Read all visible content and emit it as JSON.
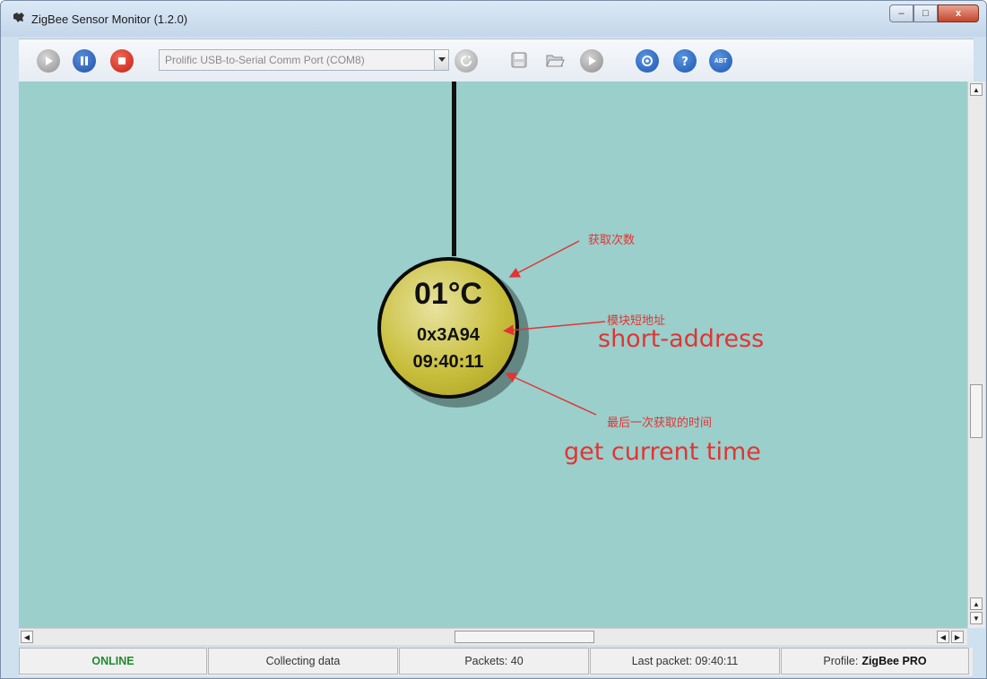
{
  "window": {
    "title": "ZigBee Sensor Monitor (1.2.0)",
    "controls": {
      "minimize": "–",
      "maximize": "□",
      "close": "x"
    }
  },
  "toolbar": {
    "port_select_value": "Prolific USB-to-Serial Comm Port (COM8)",
    "about_label": "ABT"
  },
  "node": {
    "temperature": "01°C",
    "short_address": "0x3A94",
    "last_time": "09:40:11",
    "color": "#c9bf3e"
  },
  "annotations": {
    "count_cn": "获取次数",
    "address_cn": "模块短地址",
    "address_en": "short-address",
    "time_cn": "最后一次获取的时间",
    "time_en": "get current time",
    "color": "#e03535"
  },
  "statusbar": {
    "connection": "ONLINE",
    "state": "Collecting data",
    "packets": "Packets: 40",
    "last_packet": "Last packet: 09:40:11",
    "profile_label": "Profile:",
    "profile_value": "ZigBee PRO"
  },
  "colors": {
    "canvas_bg": "#9acfcb",
    "online": "#1f8a2e"
  }
}
